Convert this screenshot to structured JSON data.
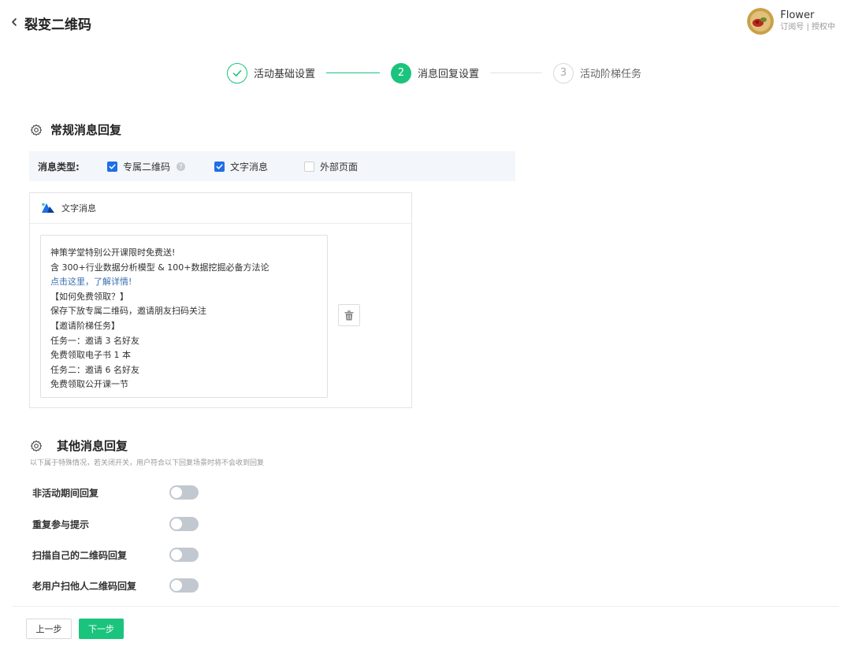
{
  "header": {
    "title": "裂变二维码",
    "account_name": "Flower",
    "account_sub": "订阅号 | 授权中"
  },
  "steps": [
    {
      "num": "1",
      "label": "活动基础设置",
      "state": "done"
    },
    {
      "num": "2",
      "label": "消息回复设置",
      "state": "active"
    },
    {
      "num": "3",
      "label": "活动阶梯任务",
      "state": "todo"
    }
  ],
  "regular": {
    "title": "常规消息回复",
    "type_label": "消息类型:",
    "options": [
      {
        "label": "专属二维码",
        "checked": true
      },
      {
        "label": "文字消息",
        "checked": true
      },
      {
        "label": "外部页面",
        "checked": false
      }
    ],
    "card_title": "文字消息",
    "message_lines": [
      "神策学堂特别公开课限时免费送!",
      "含 300+行业数据分析模型 & 100+数据挖掘必备方法论",
      "点击这里，了解详情!",
      "【如何免费领取？】",
      "保存下放专属二维码，邀请朋友扫码关注",
      "【邀请阶梯任务】",
      "任务一：邀请 3 名好友",
      "免费领取电子书 1 本",
      "任务二：邀请 6 名好友",
      "免费领取公开课一节"
    ]
  },
  "other": {
    "title": "其他消息回复",
    "description": "以下属于特殊情况，若关闭开关，用户符合以下回复场景时将不会收到回复",
    "toggles": [
      {
        "label": "非活动期间回复",
        "on": false
      },
      {
        "label": "重复参与提示",
        "on": false
      },
      {
        "label": "扫描自己的二维码回复",
        "on": false
      },
      {
        "label": "老用户扫他人二维码回复",
        "on": false
      }
    ]
  },
  "footer": {
    "prev_label": "上一步",
    "next_label": "下一步"
  },
  "colors": {
    "primary_green": "#1bc47d",
    "checkbox_blue": "#1f6fe5",
    "link_blue": "#3a6fb0"
  }
}
